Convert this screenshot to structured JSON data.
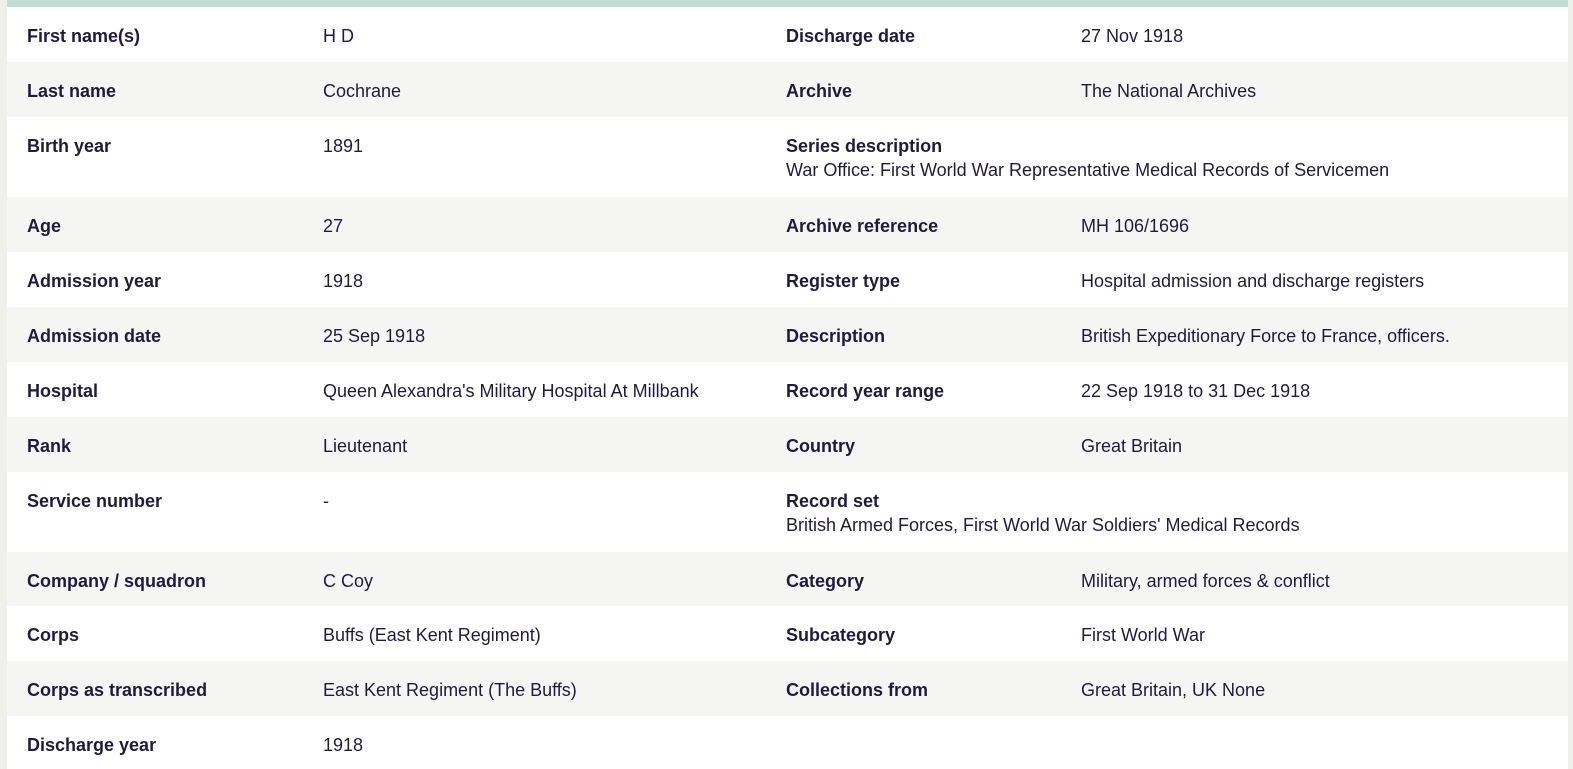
{
  "left": [
    {
      "label": "First name(s)",
      "value": "H D"
    },
    {
      "label": "Last name",
      "value": "Cochrane"
    },
    {
      "label": "Birth year",
      "value": "1891"
    },
    {
      "label": "Age",
      "value": "27"
    },
    {
      "label": "Admission year",
      "value": "1918"
    },
    {
      "label": "Admission date",
      "value": "25 Sep 1918"
    },
    {
      "label": "Hospital",
      "value": "Queen Alexandra's Military Hospital At Millbank"
    },
    {
      "label": "Rank",
      "value": "Lieutenant"
    },
    {
      "label": "Service number",
      "value": "-"
    },
    {
      "label": "Company / squadron",
      "value": "C Coy"
    },
    {
      "label": "Corps",
      "value": "Buffs (East Kent Regiment)"
    },
    {
      "label": "Corps as transcribed",
      "value": "East Kent Regiment (The Buffs)"
    },
    {
      "label": "Discharge year",
      "value": "1918"
    }
  ],
  "right": [
    {
      "label": "Discharge date",
      "value": "27 Nov 1918"
    },
    {
      "label": "Archive",
      "value": "The National Archives"
    },
    {
      "label": "Series description",
      "value": "War Office: First World War Representative Medical Records of Servicemen"
    },
    {
      "label": "Archive reference",
      "value": "MH 106/1696"
    },
    {
      "label": "Register type",
      "value": "Hospital admission and discharge registers"
    },
    {
      "label": "Description",
      "value": "British Expeditionary Force to France, officers."
    },
    {
      "label": "Record year range",
      "value": "22 Sep 1918 to 31 Dec 1918"
    },
    {
      "label": "Country",
      "value": "Great Britain"
    },
    {
      "label": "Record set",
      "value": "British Armed Forces, First World War Soldiers' Medical Records"
    },
    {
      "label": "Category",
      "value": "Military, armed forces & conflict"
    },
    {
      "label": "Subcategory",
      "value": "First World War"
    },
    {
      "label": "Collections from",
      "value": "Great Britain, UK None"
    }
  ]
}
